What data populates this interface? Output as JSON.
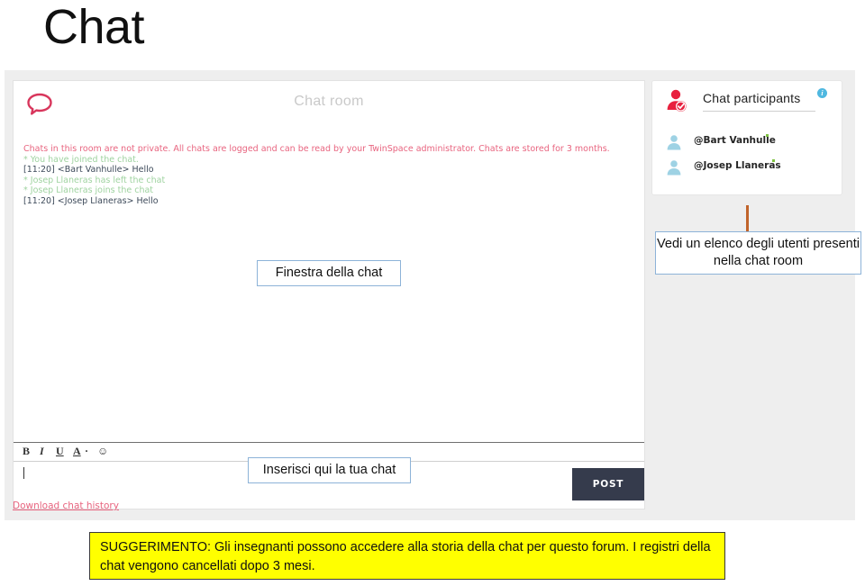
{
  "slide": {
    "title": "Chat"
  },
  "chat_card": {
    "bubble_icon": "speech-bubble-icon",
    "room_title": "Chat room",
    "log": [
      {
        "kind": "notice",
        "text": "Chats in this room are not private. All chats are logged and can be read by your TwinSpace administrator. Chats are stored for 3 months."
      },
      {
        "kind": "system",
        "text": "* You have joined the chat."
      },
      {
        "kind": "message",
        "text": "[11:20] <Bart Vanhulle>  Hello"
      },
      {
        "kind": "system",
        "text": "* Josep Llaneras has left the chat"
      },
      {
        "kind": "system",
        "text": "* Josep Llaneras joins the chat"
      },
      {
        "kind": "message",
        "text": "[11:20] <Josep Llaneras>  Hello"
      }
    ],
    "toolbar": {
      "bold": "B",
      "italic": "I",
      "underline": "U",
      "text_color": "A",
      "color_caret": "·",
      "emoji": "☺"
    },
    "composer": {
      "value": "",
      "placeholder": ""
    },
    "post_label": "POST",
    "download_label": "Download chat history"
  },
  "participants_card": {
    "header_icon": "user-check-icon",
    "title": "Chat participants",
    "info_icon_label": "i",
    "items": [
      {
        "avatar_icon": "user-icon",
        "name": "@Bart Vanhulle",
        "status": "online"
      },
      {
        "avatar_icon": "user-icon",
        "name": "@Josep Llaneras",
        "status": "online"
      }
    ]
  },
  "callouts": {
    "chat_window": "Finestra della chat",
    "insert_chat": "Inserisci qui la tua chat",
    "users_list": "Vedi un elenco degli utenti presenti nella chat room"
  },
  "tip": {
    "text": "SUGGERIMENTO: Gli insegnanti possono accedere alla storia della chat per questo forum. I registri della chat vengono cancellati dopo 3 mesi."
  },
  "colors": {
    "accent_red": "#e8647f",
    "post_button": "#353b4c",
    "tip_background": "#ffff00",
    "callout_border": "#8db3d8",
    "connector": "#c0632a",
    "status_dot": "#7fc241",
    "info_icon": "#4fb8e0"
  }
}
